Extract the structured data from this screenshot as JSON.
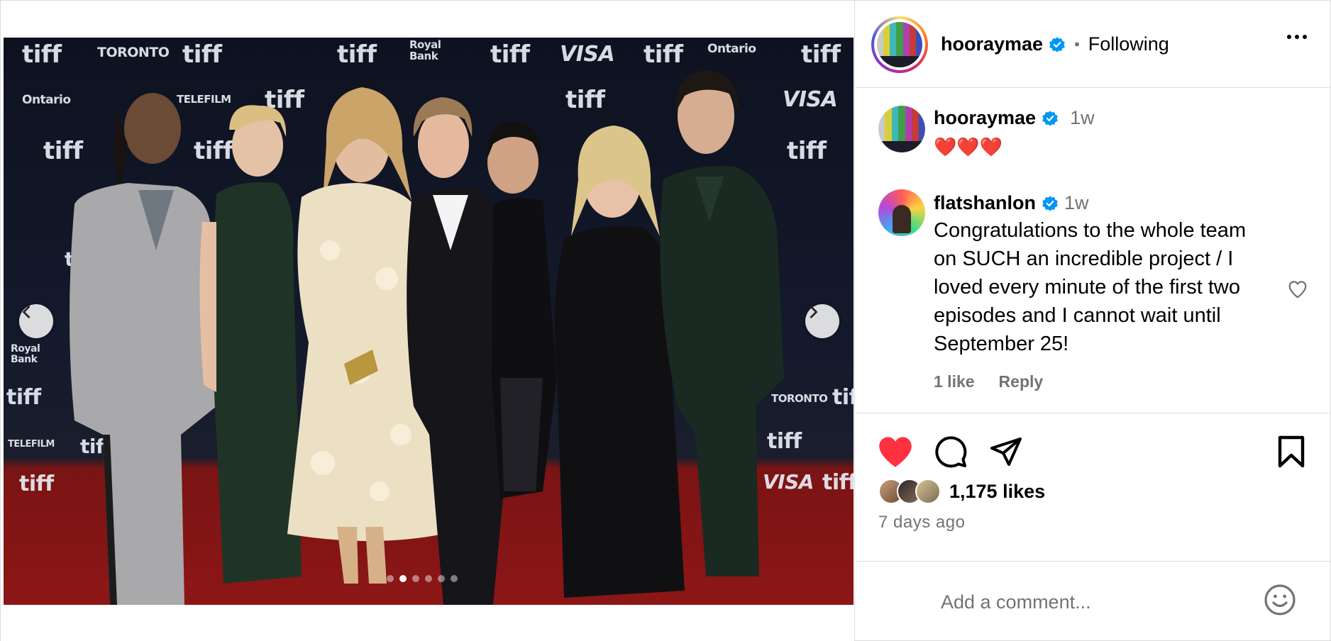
{
  "colors": {
    "like_red": "#ff3040",
    "verified_blue": "#0095f6",
    "muted_text": "#737373",
    "border": "#dbdbdb"
  },
  "media": {
    "backdrop_logos": [
      "tiff",
      "TORONTO",
      "tiff",
      "tiff",
      "Royal Bank",
      "tiff",
      "VISA",
      "tiff",
      "Ontario",
      "tiff",
      "Ontario",
      "TELEFILM",
      "tiff",
      "tiff",
      "VISA",
      "tiff",
      "tiff",
      "tiff",
      "tiff",
      "tiff",
      "VISA",
      "tiff",
      "TORONTO",
      "tiff",
      "tiff",
      "TELEFILM",
      "tiff",
      "tiff",
      "Royal Bank"
    ],
    "carousel": {
      "total_slides": 6,
      "active_slide": 2
    },
    "prev_icon": "chevron-left-icon",
    "next_icon": "chevron-right-icon"
  },
  "header": {
    "username": "hooraymae",
    "separator": "•",
    "follow_status": "Following",
    "more_icon": "more-horizontal-icon"
  },
  "comments": [
    {
      "username": "hooraymae",
      "time": "1w",
      "text": "❤️❤️❤️"
    },
    {
      "username": "flatshanlon",
      "time": "1w",
      "text": "Congratulations to the whole team on SUCH an incredible project / I loved every minute of the first two episodes and I cannot wait until September 25!",
      "likes": "1 like",
      "reply": "Reply"
    }
  ],
  "actions": {
    "like_icon": "heart-filled-icon",
    "comment_icon": "comment-icon",
    "share_icon": "send-icon",
    "save_icon": "bookmark-icon"
  },
  "likes": {
    "count_text": "1,175 likes"
  },
  "posted": "7 days ago",
  "add_comment": {
    "placeholder": "Add a comment...",
    "emoji_icon": "emoji-icon"
  }
}
